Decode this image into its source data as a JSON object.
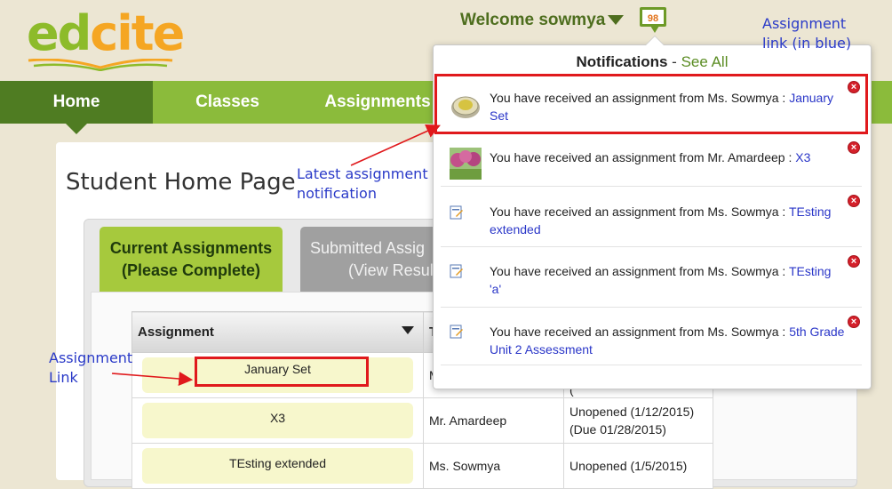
{
  "header": {
    "logo_text_1": "ed",
    "logo_text_2": "cite",
    "welcome": "Welcome sowmya",
    "notification_count": "98"
  },
  "nav": {
    "items": [
      "Home",
      "Classes",
      "Assignments"
    ],
    "active": "Home"
  },
  "main": {
    "page_title": "Student Home Page",
    "tab_current_line1": "Current Assignments",
    "tab_current_line2": "(Please Complete)",
    "tab_submitted_line1": "Submitted Assig",
    "tab_submitted_line2": "(View Resul",
    "table": {
      "col_assignment": "Assignment",
      "col_teacher": "T",
      "rows": [
        {
          "assignment": "January Set",
          "teacher": "M",
          "status_1": "(",
          "status_2": ""
        },
        {
          "assignment": "X3",
          "teacher": "Mr. Amardeep",
          "status_1": "Unopened (1/12/2015)",
          "status_2": "(Due 01/28/2015)"
        },
        {
          "assignment": "TEsting extended",
          "teacher": "Ms. Sowmya",
          "status_1": "Unopened (1/5/2015)",
          "status_2": ""
        }
      ]
    }
  },
  "notifications": {
    "title": "Notifications",
    "separator": " - ",
    "see_all": "See All",
    "items": [
      {
        "text": "You have received an assignment from Ms. Sowmya : ",
        "link": "January Set",
        "thumb": "coin-icon"
      },
      {
        "text": "You have received an assignment from Mr. Amardeep : ",
        "link": "X3",
        "thumb": "tree-photo"
      },
      {
        "text": "You have received an assignment from Ms. Sowmya : ",
        "link": "TEsting extended",
        "thumb": "assignment-doc-icon"
      },
      {
        "text": "You have received an assignment from Ms. Sowmya : ",
        "link": "TEsting 'a'",
        "thumb": "assignment-doc-icon"
      },
      {
        "text": "You have received an assignment from Ms. Sowmya : ",
        "link": "5th Grade Unit 2 Assessment",
        "thumb": "assignment-doc-icon"
      }
    ]
  },
  "annotations": {
    "top_right_line1": "Assignment",
    "top_right_line2": "link (in blue)",
    "latest_line1": "Latest assignment",
    "latest_line2": "notification",
    "left_line1": "Assignment",
    "left_line2": "Link"
  },
  "colors": {
    "brand_green": "#8bbb3b",
    "nav_active": "#4f7c22",
    "link_blue": "#2a36c8",
    "annotation_red": "#e0191c",
    "annotation_blue": "#2a3ac8"
  }
}
